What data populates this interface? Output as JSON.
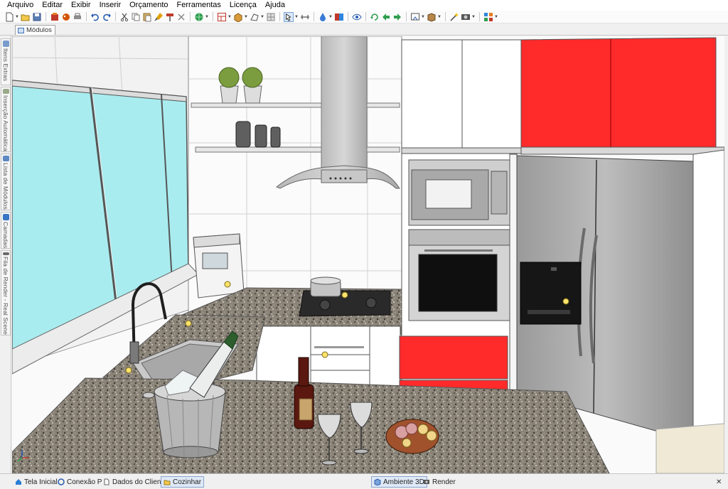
{
  "menu": [
    "Arquivo",
    "Editar",
    "Exibir",
    "Inserir",
    "Orçamento",
    "Ferramentas",
    "Licença",
    "Ajuda"
  ],
  "toolbar": {
    "icons": [
      "new-file-icon",
      "open-folder-icon",
      "save-icon",
      "library-icon",
      "palette-icon",
      "print-icon",
      "undo-icon",
      "redo-icon",
      "cut-icon",
      "copy-icon",
      "paste-icon",
      "brush-icon",
      "paint-roller-icon",
      "delete-icon",
      "globe-icon",
      "modules-icon",
      "box-icon",
      "shape-icon",
      "grid-icon",
      "pointer-icon",
      "measure-icon",
      "color-drop-icon",
      "material-icon",
      "eye-icon",
      "rotate-icon",
      "move-left-icon",
      "move-right-icon",
      "camera-icon",
      "package-icon",
      "wand-icon",
      "render-icon",
      "layout-icon"
    ]
  },
  "tab": {
    "label": "Módulos"
  },
  "leftdock": {
    "tabs": [
      "Itens Extras",
      "Inserção Automática",
      "Lista de Módulos",
      "Camadas",
      "Fila de Render - Real Scene"
    ]
  },
  "statusbar": {
    "tabs": [
      {
        "label": "Tela Inicial",
        "icon": "home-icon"
      },
      {
        "label": "Conexão P",
        "icon": "connection-icon"
      },
      {
        "label": "Dados do Cliente",
        "icon": "document-icon"
      },
      {
        "label": "Cozinhar",
        "icon": "folder-icon"
      }
    ],
    "view_tabs": [
      {
        "label": "Ambiente 3D",
        "icon": "cube-icon"
      },
      {
        "label": "Render",
        "icon": "render-icon"
      }
    ],
    "close_symbol": "✕"
  },
  "colors": {
    "accent_red": "#ff2a2a",
    "window_glass": "#a9ecef",
    "granite": "#8a8378",
    "steel": "#a8a8a8"
  }
}
